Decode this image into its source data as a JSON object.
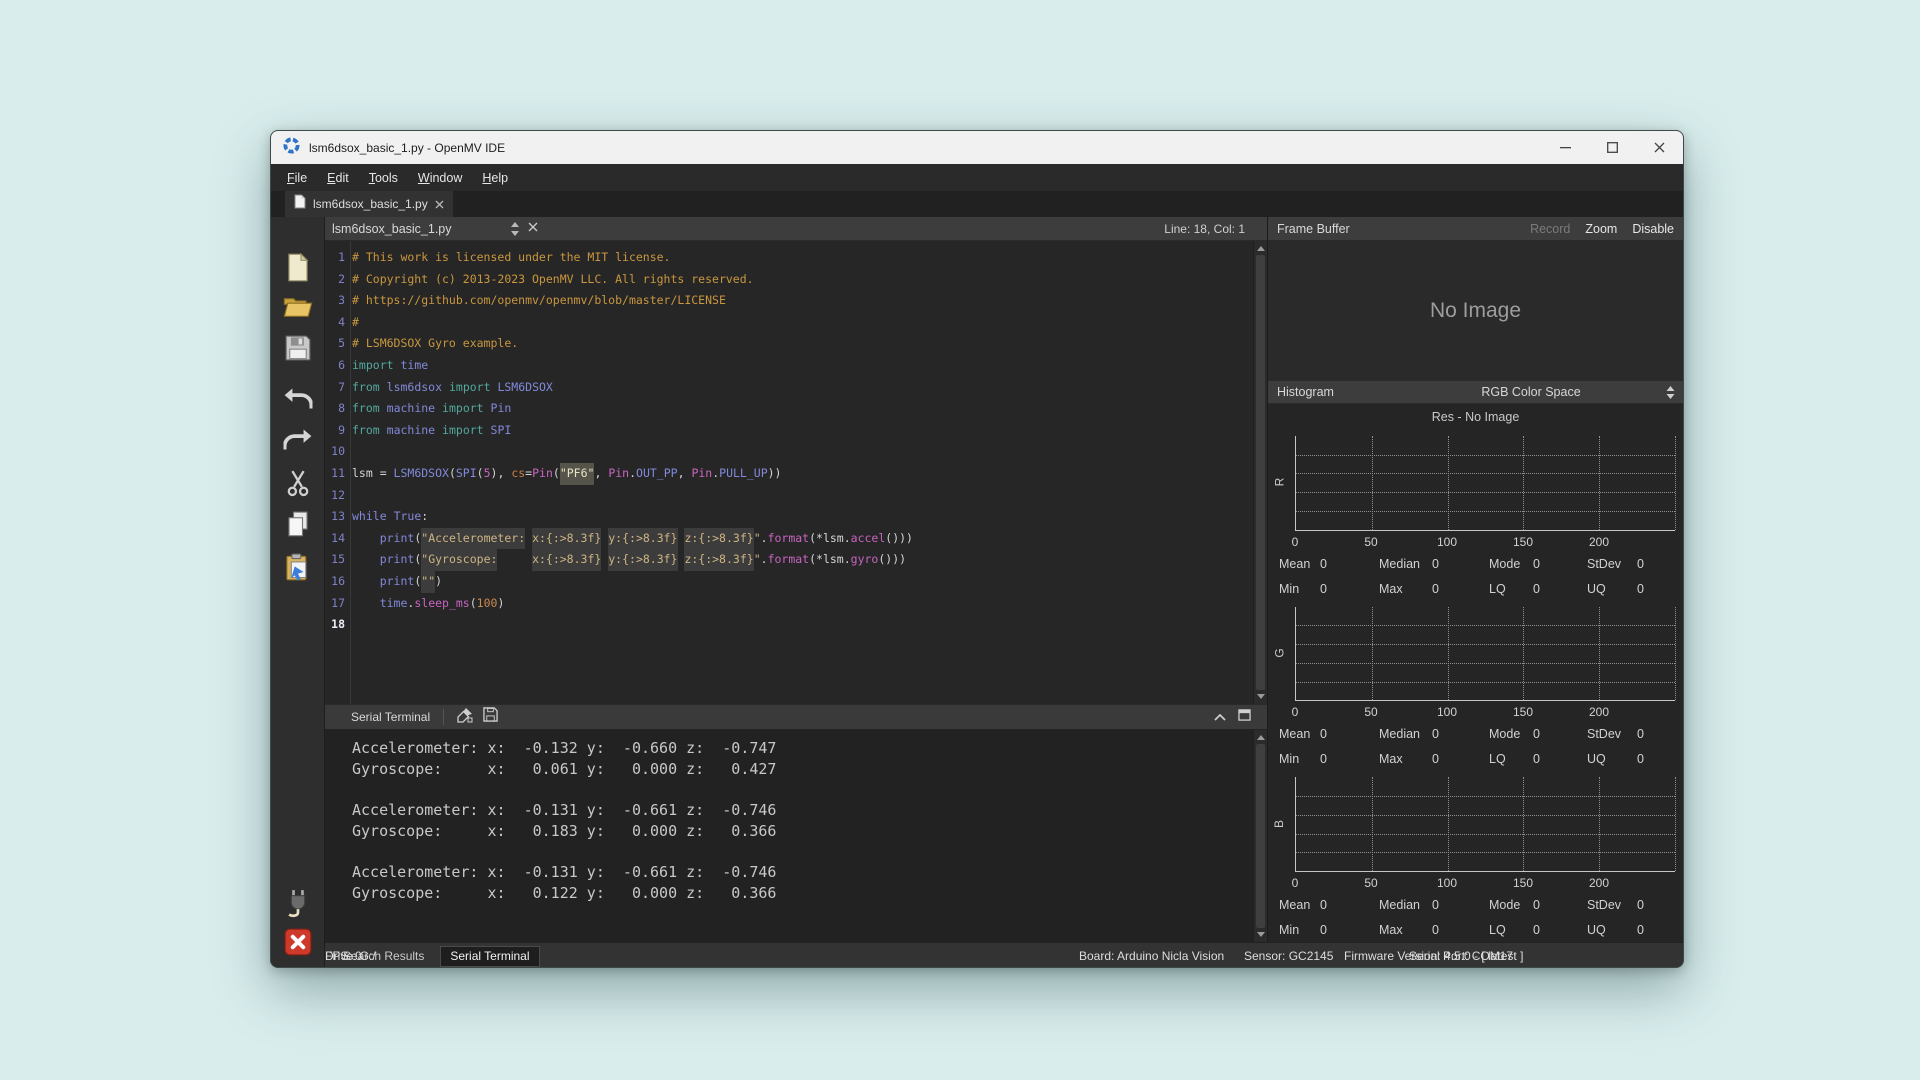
{
  "window": {
    "title": "lsm6dsox_basic_1.py - OpenMV IDE",
    "controls": [
      {
        "name": "minimize"
      },
      {
        "name": "maximize"
      },
      {
        "name": "close"
      }
    ]
  },
  "menu": {
    "items": [
      {
        "key": "F",
        "rest": "ile"
      },
      {
        "key": "E",
        "rest": "dit"
      },
      {
        "key": "T",
        "rest": "ools"
      },
      {
        "key": "W",
        "rest": "indow"
      },
      {
        "key": "H",
        "rest": "elp"
      }
    ]
  },
  "tab": {
    "label": "lsm6dsox_basic_1.py"
  },
  "toolbar": {
    "icons": [
      "new-file",
      "open-file",
      "save-file",
      "undo",
      "redo",
      "cut",
      "copy",
      "paste",
      "connect",
      "stop"
    ]
  },
  "editor": {
    "doc_title": "lsm6dsox_basic_1.py",
    "line_col": "Line: 18, Col: 1",
    "code_lines": [
      {
        "num": 1,
        "segments": [
          {
            "s": "c",
            "t": "# This work is licensed under the MIT license."
          }
        ]
      },
      {
        "num": 2,
        "segments": [
          {
            "s": "c",
            "t": "# Copyright (c) 2013-2023 OpenMV LLC. All rights reserved."
          }
        ]
      },
      {
        "num": 3,
        "segments": [
          {
            "s": "c",
            "t": "# https://github.com/openmv/openmv/blob/master/LICENSE"
          }
        ]
      },
      {
        "num": 4,
        "segments": [
          {
            "s": "c",
            "t": "#"
          }
        ]
      },
      {
        "num": 5,
        "segments": [
          {
            "s": "c",
            "t": "# LSM6DSOX Gyro example."
          }
        ]
      },
      {
        "num": 6,
        "segments": [
          {
            "s": "kw",
            "t": "import"
          },
          {
            "s": "p",
            "t": " "
          },
          {
            "s": "ty",
            "t": "time"
          }
        ]
      },
      {
        "num": 7,
        "segments": [
          {
            "s": "kw",
            "t": "from"
          },
          {
            "s": "p",
            "t": " "
          },
          {
            "s": "ty",
            "t": "lsm6dsox"
          },
          {
            "s": "p",
            "t": " "
          },
          {
            "s": "kw",
            "t": "import"
          },
          {
            "s": "p",
            "t": " "
          },
          {
            "s": "ty",
            "t": "LSM6DSOX"
          }
        ]
      },
      {
        "num": 8,
        "segments": [
          {
            "s": "kw",
            "t": "from"
          },
          {
            "s": "p",
            "t": " "
          },
          {
            "s": "ty",
            "t": "machine"
          },
          {
            "s": "p",
            "t": " "
          },
          {
            "s": "kw",
            "t": "import"
          },
          {
            "s": "p",
            "t": " "
          },
          {
            "s": "ty",
            "t": "Pin"
          }
        ]
      },
      {
        "num": 9,
        "segments": [
          {
            "s": "kw",
            "t": "from"
          },
          {
            "s": "p",
            "t": " "
          },
          {
            "s": "ty",
            "t": "machine"
          },
          {
            "s": "p",
            "t": " "
          },
          {
            "s": "kw",
            "t": "import"
          },
          {
            "s": "p",
            "t": " "
          },
          {
            "s": "ty",
            "t": "SPI"
          }
        ]
      },
      {
        "num": 10,
        "segments": []
      },
      {
        "num": 11,
        "segments": [
          {
            "s": "p",
            "t": "lsm = "
          },
          {
            "s": "ty",
            "t": "LSM6DSOX"
          },
          {
            "s": "p",
            "t": "("
          },
          {
            "s": "ty",
            "t": "SPI"
          },
          {
            "s": "p",
            "t": "("
          },
          {
            "s": "mg",
            "t": "5"
          },
          {
            "s": "p",
            "t": "), "
          },
          {
            "s": "pr",
            "t": "cs"
          },
          {
            "s": "p",
            "t": "="
          },
          {
            "s": "mg",
            "t": "Pin"
          },
          {
            "s": "p",
            "t": "("
          },
          {
            "s": "sh",
            "t": "\"PF6\""
          },
          {
            "s": "p",
            "t": ", "
          },
          {
            "s": "mg",
            "t": "Pin"
          },
          {
            "s": "p",
            "t": "."
          },
          {
            "s": "ty",
            "t": "OUT_PP"
          },
          {
            "s": "p",
            "t": ", "
          },
          {
            "s": "mg",
            "t": "Pin"
          },
          {
            "s": "p",
            "t": "."
          },
          {
            "s": "ty",
            "t": "PULL_UP"
          },
          {
            "s": "p",
            "t": "))"
          }
        ]
      },
      {
        "num": 12,
        "segments": []
      },
      {
        "num": 13,
        "segments": [
          {
            "s": "ty",
            "t": "while"
          },
          {
            "s": "p",
            "t": " "
          },
          {
            "s": "ty",
            "t": "True"
          },
          {
            "s": "p",
            "t": ":"
          }
        ]
      },
      {
        "num": 14,
        "segments": [
          {
            "s": "p",
            "t": "    "
          },
          {
            "s": "ty",
            "t": "print"
          },
          {
            "s": "p",
            "t": "("
          },
          {
            "s": "st",
            "t": "\"Accelerometer:"
          },
          {
            "s": "p",
            "t": " "
          },
          {
            "s": "st",
            "t": "x:{:>8.3f}"
          },
          {
            "s": "p",
            "t": " "
          },
          {
            "s": "st",
            "t": "y:{:>8.3f}"
          },
          {
            "s": "p",
            "t": " "
          },
          {
            "s": "st",
            "t": "z:{:>8.3f}"
          },
          {
            "s": "s2",
            "t": "\""
          },
          {
            "s": "p",
            "t": "."
          },
          {
            "s": "mg",
            "t": "format"
          },
          {
            "s": "p",
            "t": "(*lsm."
          },
          {
            "s": "mg",
            "t": "accel"
          },
          {
            "s": "p",
            "t": "()))"
          }
        ]
      },
      {
        "num": 15,
        "segments": [
          {
            "s": "p",
            "t": "    "
          },
          {
            "s": "ty",
            "t": "print"
          },
          {
            "s": "p",
            "t": "("
          },
          {
            "s": "st",
            "t": "\"Gyroscope:"
          },
          {
            "s": "p",
            "t": "     "
          },
          {
            "s": "st",
            "t": "x:{:>8.3f}"
          },
          {
            "s": "p",
            "t": " "
          },
          {
            "s": "st",
            "t": "y:{:>8.3f}"
          },
          {
            "s": "p",
            "t": " "
          },
          {
            "s": "st",
            "t": "z:{:>8.3f}"
          },
          {
            "s": "s2",
            "t": "\""
          },
          {
            "s": "p",
            "t": "."
          },
          {
            "s": "mg",
            "t": "format"
          },
          {
            "s": "p",
            "t": "(*lsm."
          },
          {
            "s": "mg",
            "t": "gyro"
          },
          {
            "s": "p",
            "t": "()))"
          }
        ]
      },
      {
        "num": 16,
        "segments": [
          {
            "s": "p",
            "t": "    "
          },
          {
            "s": "ty",
            "t": "print"
          },
          {
            "s": "p",
            "t": "("
          },
          {
            "s": "st",
            "t": "\"\""
          },
          {
            "s": "p",
            "t": ")"
          }
        ]
      },
      {
        "num": 17,
        "segments": [
          {
            "s": "p",
            "t": "    "
          },
          {
            "s": "ty",
            "t": "time"
          },
          {
            "s": "p",
            "t": "."
          },
          {
            "s": "mg",
            "t": "sleep_ms"
          },
          {
            "s": "p",
            "t": "("
          },
          {
            "s": "nu",
            "t": "100"
          },
          {
            "s": "p",
            "t": ")"
          }
        ]
      },
      {
        "num": 18,
        "segments": [],
        "current": true
      }
    ]
  },
  "terminal": {
    "panel_title": "Serial Terminal",
    "lines": [
      "Accelerometer: x:  -0.132 y:  -0.660 z:  -0.747",
      "Gyroscope:     x:   0.061 y:   0.000 z:   0.427",
      "",
      "Accelerometer: x:  -0.131 y:  -0.661 z:  -0.746",
      "Gyroscope:     x:   0.183 y:   0.000 z:   0.366",
      "",
      "Accelerometer: x:  -0.131 y:  -0.661 z:  -0.746",
      "Gyroscope:     x:   0.122 y:   0.000 z:   0.366"
    ]
  },
  "frame_buffer": {
    "title": "Frame Buffer",
    "actions": [
      {
        "label": "Record",
        "enabled": false
      },
      {
        "label": "Zoom",
        "enabled": true
      },
      {
        "label": "Disable",
        "enabled": true
      }
    ],
    "placeholder": "No Image"
  },
  "histogram": {
    "title": "Histogram",
    "color_space": "RGB Color Space",
    "res_text": "Res - No Image",
    "channels": [
      "R",
      "G",
      "B"
    ],
    "ticks": [
      "0",
      "50",
      "100",
      "150",
      "200"
    ],
    "stat_rows": [
      [
        {
          "label": "Mean",
          "value": "0"
        },
        {
          "label": "Median",
          "value": "0"
        },
        {
          "label": "Mode",
          "value": "0"
        },
        {
          "label": "StDev",
          "value": "0"
        }
      ],
      [
        {
          "label": "Min",
          "value": "0"
        },
        {
          "label": "Max",
          "value": "0"
        },
        {
          "label": "LQ",
          "value": "0"
        },
        {
          "label": "UQ",
          "value": "0"
        }
      ]
    ]
  },
  "status_bar": {
    "tabs": [
      {
        "label": "Search Results",
        "active": false
      },
      {
        "label": "Serial Terminal",
        "active": true
      }
    ],
    "fields": [
      {
        "label": "Board: Arduino Nicla Vision"
      },
      {
        "label": "Sensor: GC2145"
      },
      {
        "label": "Firmware Version: 4.5.0 - [ latest ]"
      },
      {
        "label": "Serial Port: COM17"
      },
      {
        "label": "Drive: G:/"
      },
      {
        "label": "FPS: 0"
      }
    ]
  },
  "colors": {
    "desktop_bg": "#d9eded",
    "titlebar_bg": "#f1f1f1",
    "editor_bg": "#262626",
    "accent_logo_blue": "#2e73c8",
    "stop_red": "#cd3a2a",
    "comment_gold": "#c9973f",
    "keyword_teal": "#52a89d",
    "ident_periwinkle": "#8289d9",
    "call_magenta": "#c765c0",
    "string_tan": "#cdb483"
  }
}
